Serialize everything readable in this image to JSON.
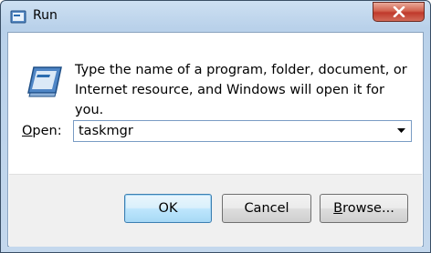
{
  "window": {
    "title": "Run",
    "close_glyph": "✕",
    "title_icon": "run-app-icon",
    "accent_color": "#c0392b"
  },
  "body": {
    "icon": "run-dialog-icon",
    "description": "Type the name of a program, folder, document, or Internet resource, and Windows will open it for you."
  },
  "open_field": {
    "label_accel": "O",
    "label_rest": "pen:",
    "value": "taskmgr",
    "dropdown_icon": "chevron-down-icon"
  },
  "buttons": {
    "ok_label": "OK",
    "cancel_label": "Cancel",
    "browse_accel": "B",
    "browse_rest": "rowse..."
  }
}
